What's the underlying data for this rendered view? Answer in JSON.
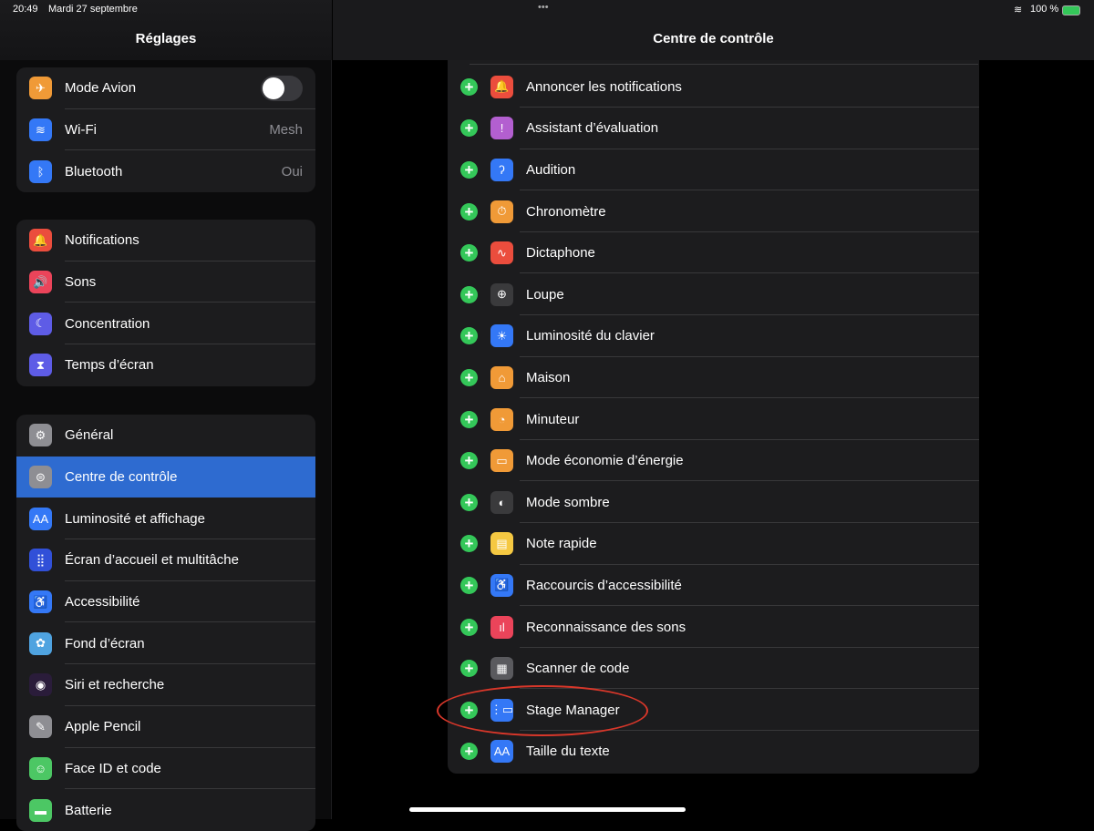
{
  "status": {
    "time": "20:49",
    "date": "Mardi 27 septembre",
    "battery": "100 %",
    "multitask": "•••"
  },
  "sidebar": {
    "title": "Réglages",
    "groups": [
      [
        {
          "label": "Mode Avion",
          "icon": "airplane-icon",
          "glyph": "✈",
          "color": "#f09a37",
          "toggle": false
        },
        {
          "label": "Wi-Fi",
          "icon": "wifi-icon",
          "glyph": "≋",
          "color": "#3478f6",
          "value": "Mesh"
        },
        {
          "label": "Bluetooth",
          "icon": "bluetooth-icon",
          "glyph": "ᛒ",
          "color": "#3478f6",
          "value": "Oui"
        }
      ],
      [
        {
          "label": "Notifications",
          "icon": "bell-icon",
          "glyph": "🔔",
          "color": "#eb4d3d"
        },
        {
          "label": "Sons",
          "icon": "speaker-icon",
          "glyph": "🔊",
          "color": "#eb445a"
        },
        {
          "label": "Concentration",
          "icon": "moon-icon",
          "glyph": "☾",
          "color": "#5e5ce6"
        },
        {
          "label": "Temps d’écran",
          "icon": "hourglass-icon",
          "glyph": "⧗",
          "color": "#5e5ce6"
        }
      ],
      [
        {
          "label": "Général",
          "icon": "gear-icon",
          "glyph": "⚙",
          "color": "#8e8e93"
        },
        {
          "label": "Centre de contrôle",
          "icon": "switches-icon",
          "glyph": "⊜",
          "color": "#8e8e93",
          "selected": true
        },
        {
          "label": "Luminosité et affichage",
          "icon": "text-size-icon",
          "glyph": "AA",
          "color": "#3478f6"
        },
        {
          "label": "Écran d’accueil et multitâche",
          "icon": "grid-icon",
          "glyph": "⣿",
          "color": "#3150d8"
        },
        {
          "label": "Accessibilité",
          "icon": "accessibility-icon",
          "glyph": "♿",
          "color": "#3478f6"
        },
        {
          "label": "Fond d’écran",
          "icon": "flower-icon",
          "glyph": "✿",
          "color": "#4fa3e0"
        },
        {
          "label": "Siri et recherche",
          "icon": "siri-icon",
          "glyph": "◉",
          "color": "#2a1c3a"
        },
        {
          "label": "Apple Pencil",
          "icon": "pencil-icon",
          "glyph": "✎",
          "color": "#8e8e93"
        },
        {
          "label": "Face ID et code",
          "icon": "faceid-icon",
          "glyph": "☺",
          "color": "#4cc764"
        },
        {
          "label": "Batterie",
          "icon": "battery-icon",
          "glyph": "▬",
          "color": "#4cc764"
        }
      ]
    ]
  },
  "main": {
    "title": "Centre de contrôle",
    "items": [
      {
        "label": "Annoncer les notifications",
        "icon": "bell-icon",
        "glyph": "🔔",
        "color": "#eb4d3d"
      },
      {
        "label": "Assistant d’évaluation",
        "icon": "feedback-icon",
        "glyph": "!",
        "color": "#b35fd0"
      },
      {
        "label": "Audition",
        "icon": "ear-icon",
        "glyph": "ʔ",
        "color": "#3478f6"
      },
      {
        "label": "Chronomètre",
        "icon": "stopwatch-icon",
        "glyph": "⏱",
        "color": "#f09a37"
      },
      {
        "label": "Dictaphone",
        "icon": "waveform-icon",
        "glyph": "∿",
        "color": "#eb4d3d"
      },
      {
        "label": "Loupe",
        "icon": "magnifier-icon",
        "glyph": "⊕",
        "color": "#3a3a3c"
      },
      {
        "label": "Luminosité du clavier",
        "icon": "keyboard-brightness-icon",
        "glyph": "☀",
        "color": "#3478f6"
      },
      {
        "label": "Maison",
        "icon": "home-icon",
        "glyph": "⌂",
        "color": "#f09a37"
      },
      {
        "label": "Minuteur",
        "icon": "timer-icon",
        "glyph": "◔",
        "color": "#f09a37"
      },
      {
        "label": "Mode économie d’énergie",
        "icon": "low-battery-icon",
        "glyph": "▭",
        "color": "#f09a37"
      },
      {
        "label": "Mode sombre",
        "icon": "dark-mode-icon",
        "glyph": "◐",
        "color": "#3a3a3c"
      },
      {
        "label": "Note rapide",
        "icon": "quick-note-icon",
        "glyph": "▤",
        "color": "#f5c842"
      },
      {
        "label": "Raccourcis d’accessibilité",
        "icon": "accessibility-icon",
        "glyph": "♿",
        "color": "#3478f6"
      },
      {
        "label": "Reconnaissance des sons",
        "icon": "sound-recognition-icon",
        "glyph": "ıl",
        "color": "#eb445a"
      },
      {
        "label": "Scanner de code",
        "icon": "qr-code-icon",
        "glyph": "▦",
        "color": "#5a5a5e"
      },
      {
        "label": "Stage Manager",
        "icon": "stage-manager-icon",
        "glyph": "⋮▭",
        "color": "#3478f6"
      },
      {
        "label": "Taille du texte",
        "icon": "text-size-icon",
        "glyph": "AA",
        "color": "#3478f6"
      }
    ]
  }
}
